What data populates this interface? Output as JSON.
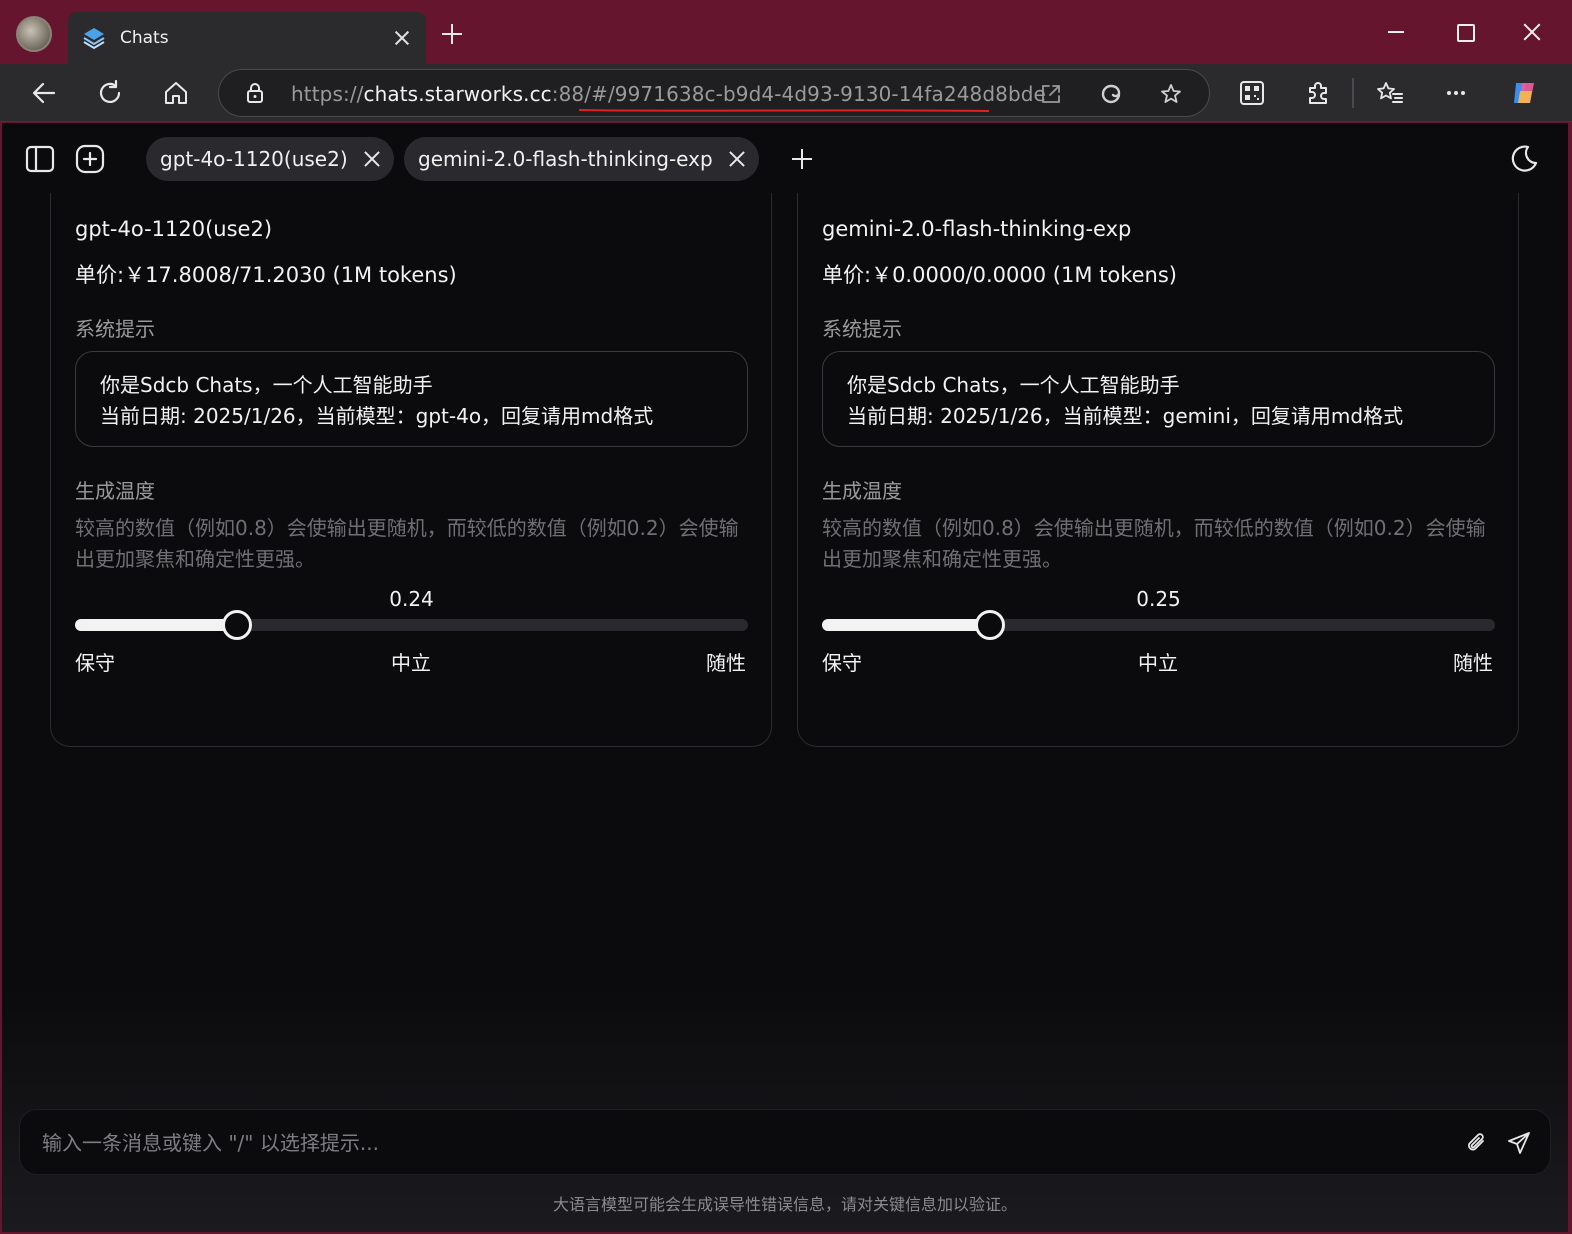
{
  "browser": {
    "tab_title": "Chats",
    "url_scheme": "https://",
    "url_host": "chats.starworks.cc",
    "url_rest": ":88/#/9971638c-b9d4-4d93-9130-14fa248d8bde",
    "accent_color": "#66152e"
  },
  "app": {
    "model_tabs": [
      {
        "label": "gpt-4o-1120(use2)"
      },
      {
        "label": "gemini-2.0-flash-thinking-exp"
      }
    ],
    "panels": [
      {
        "model": "gpt-4o-1120(use2)",
        "price": "单价:￥17.8008/71.2030 (1M tokens)",
        "system_label": "系统提示",
        "system_line1": "你是Sdcb Chats，一个人工智能助手",
        "system_line2": "当前日期: 2025/1/26，当前模型：gpt-4o，回复请用md格式",
        "temp_label": "生成温度",
        "temp_desc": "较高的数值（例如0.8）会使输出更随机，而较低的数值（例如0.2）会使输出更加聚焦和确定性更强。",
        "temp_value": "0.24",
        "temp_fraction": 0.24,
        "scale_left": "保守",
        "scale_mid": "中立",
        "scale_right": "随性"
      },
      {
        "model": "gemini-2.0-flash-thinking-exp",
        "price": "单价:￥0.0000/0.0000 (1M tokens)",
        "system_label": "系统提示",
        "system_line1": "你是Sdcb Chats，一个人工智能助手",
        "system_line2": "当前日期: 2025/1/26，当前模型：gemini，回复请用md格式",
        "temp_label": "生成温度",
        "temp_desc": "较高的数值（例如0.8）会使输出更随机，而较低的数值（例如0.2）会使输出更加聚焦和确定性更强。",
        "temp_value": "0.25",
        "temp_fraction": 0.25,
        "scale_left": "保守",
        "scale_mid": "中立",
        "scale_right": "随性"
      }
    ],
    "composer_placeholder": "输入一条消息或键入 \"/\" 以选择提示...",
    "disclaimer": "大语言模型可能会生成误导性错误信息，请对关键信息加以验证。"
  }
}
